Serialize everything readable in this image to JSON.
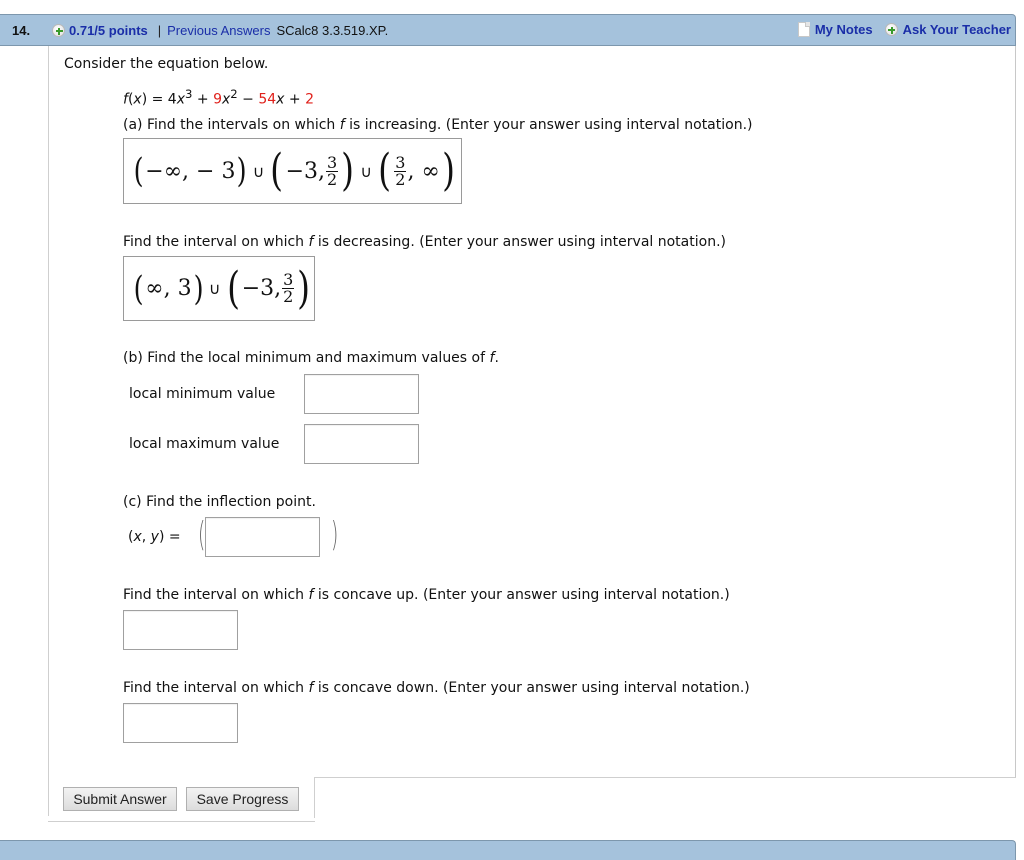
{
  "header": {
    "question_number": "14.",
    "points": "0.71/5 points",
    "separator": "|",
    "previous_answers": "Previous Answers",
    "problem_code": "SCalc8 3.3.519.XP.",
    "my_notes": "My Notes",
    "ask_teacher": "Ask Your Teacher"
  },
  "problem": {
    "intro": "Consider the equation below.",
    "equation": {
      "lhs": "f(x) = 4x",
      "exp1": "3",
      "plus1": " + ",
      "coef2": "9",
      "x2": "x",
      "exp2": "2",
      "minus": " − ",
      "coef3": "54",
      "x3": "x + ",
      "const": "2"
    },
    "part_a": {
      "prompt_prefix": "(a) Find the intervals on which ",
      "prompt_var": "f",
      "prompt_suffix": " is increasing. (Enter your answer using interval notation.)",
      "answer": {
        "open1": "(",
        "t1": "−∞, − 3",
        "close1": ")",
        "union": "∪",
        "t2": "−3,",
        "frac_num": "3",
        "frac_den": "2",
        "t3": ", ∞",
        "inf": "∞"
      },
      "decreasing_prefix": "Find the interval on which ",
      "decreasing_var": "f",
      "decreasing_suffix": " is decreasing. (Enter your answer using interval notation.)",
      "decreasing_answer": {
        "t1": "∞, 3",
        "union": "∪",
        "t2": "−3,",
        "frac_num": "3",
        "frac_den": "2"
      }
    },
    "part_b": {
      "prompt_prefix": "(b) Find the local minimum and maximum values of ",
      "prompt_var": "f",
      "prompt_suffix": ".",
      "local_min_label": "local minimum value",
      "local_min_value": "",
      "local_max_label": "local maximum value",
      "local_max_value": ""
    },
    "part_c": {
      "prompt": "(c) Find the inflection point.",
      "point_label_open": "(",
      "point_label_x": "x",
      "point_label_comma": ", ",
      "point_label_y": "y",
      "point_label_close": ") =",
      "point_value": "",
      "concave_up_prefix": "Find the interval on which ",
      "concave_up_var": "f",
      "concave_up_suffix": " is concave up. (Enter your answer using interval notation.)",
      "concave_up_value": "",
      "concave_down_prefix": "Find the interval on which ",
      "concave_down_var": "f",
      "concave_down_suffix": " is concave down. (Enter your answer using interval notation.)",
      "concave_down_value": ""
    }
  },
  "actions": {
    "submit": "Submit Answer",
    "save": "Save Progress"
  },
  "colors": {
    "header_bg": "#a5c2dc",
    "link": "#1a2ea8",
    "highlight": "#e0211b"
  }
}
